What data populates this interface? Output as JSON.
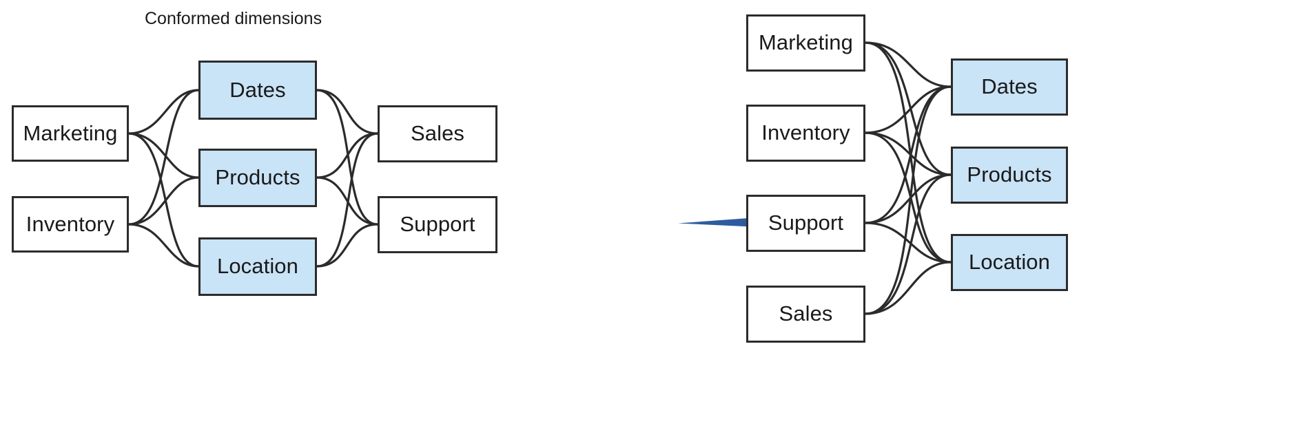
{
  "figure": {
    "title": "Conformed dimensions",
    "colors": {
      "dimension_fill": "#c9e3f7",
      "node_stroke": "#2b2b2b",
      "node_fill": "#ffffff",
      "edge_stroke": "#2b2b2b",
      "arrow_fill": "#2e5c9e",
      "background": "#ffffff",
      "text": "#1a1a1a"
    }
  },
  "left_diagram": {
    "label": "Conformed dimensions",
    "source_nodes": [
      {
        "label": "Marketing",
        "kind": "business-process"
      },
      {
        "label": "Inventory",
        "kind": "business-process"
      }
    ],
    "dimension_nodes": [
      {
        "label": "Dates",
        "kind": "conformed-dimension"
      },
      {
        "label": "Products",
        "kind": "conformed-dimension"
      },
      {
        "label": "Location",
        "kind": "conformed-dimension"
      }
    ],
    "target_nodes": [
      {
        "label": "Sales",
        "kind": "business-process"
      },
      {
        "label": "Support",
        "kind": "business-process"
      }
    ]
  },
  "transition": {
    "arrow": "right-arrow-icon",
    "direction": "right"
  },
  "right_diagram": {
    "process_nodes": [
      {
        "label": "Marketing",
        "kind": "business-process"
      },
      {
        "label": "Inventory",
        "kind": "business-process"
      },
      {
        "label": "Support",
        "kind": "business-process"
      },
      {
        "label": "Sales",
        "kind": "business-process"
      }
    ],
    "dimension_nodes": [
      {
        "label": "Dates",
        "kind": "conformed-dimension"
      },
      {
        "label": "Products",
        "kind": "conformed-dimension"
      },
      {
        "label": "Location",
        "kind": "conformed-dimension"
      }
    ]
  },
  "chart_data": {
    "type": "diagram",
    "title": "Conformed dimensions",
    "panels": [
      {
        "name": "before",
        "columns": [
          {
            "role": "sources",
            "nodes": [
              "Marketing",
              "Inventory"
            ]
          },
          {
            "role": "conformed-dimensions",
            "nodes": [
              "Dates",
              "Products",
              "Location"
            ]
          },
          {
            "role": "targets",
            "nodes": [
              "Sales",
              "Support"
            ]
          }
        ],
        "edges": [
          [
            "Marketing",
            "Dates"
          ],
          [
            "Marketing",
            "Products"
          ],
          [
            "Marketing",
            "Location"
          ],
          [
            "Inventory",
            "Dates"
          ],
          [
            "Inventory",
            "Products"
          ],
          [
            "Inventory",
            "Location"
          ],
          [
            "Dates",
            "Sales"
          ],
          [
            "Dates",
            "Support"
          ],
          [
            "Products",
            "Sales"
          ],
          [
            "Products",
            "Support"
          ],
          [
            "Location",
            "Sales"
          ],
          [
            "Location",
            "Support"
          ]
        ]
      },
      {
        "name": "after",
        "columns": [
          {
            "role": "processes",
            "nodes": [
              "Marketing",
              "Inventory",
              "Support",
              "Sales"
            ]
          },
          {
            "role": "conformed-dimensions",
            "nodes": [
              "Dates",
              "Products",
              "Location"
            ]
          }
        ],
        "edges": [
          [
            "Marketing",
            "Dates"
          ],
          [
            "Marketing",
            "Products"
          ],
          [
            "Marketing",
            "Location"
          ],
          [
            "Inventory",
            "Dates"
          ],
          [
            "Inventory",
            "Products"
          ],
          [
            "Inventory",
            "Location"
          ],
          [
            "Support",
            "Dates"
          ],
          [
            "Support",
            "Products"
          ],
          [
            "Support",
            "Location"
          ],
          [
            "Sales",
            "Dates"
          ],
          [
            "Sales",
            "Products"
          ],
          [
            "Sales",
            "Location"
          ]
        ]
      }
    ]
  }
}
